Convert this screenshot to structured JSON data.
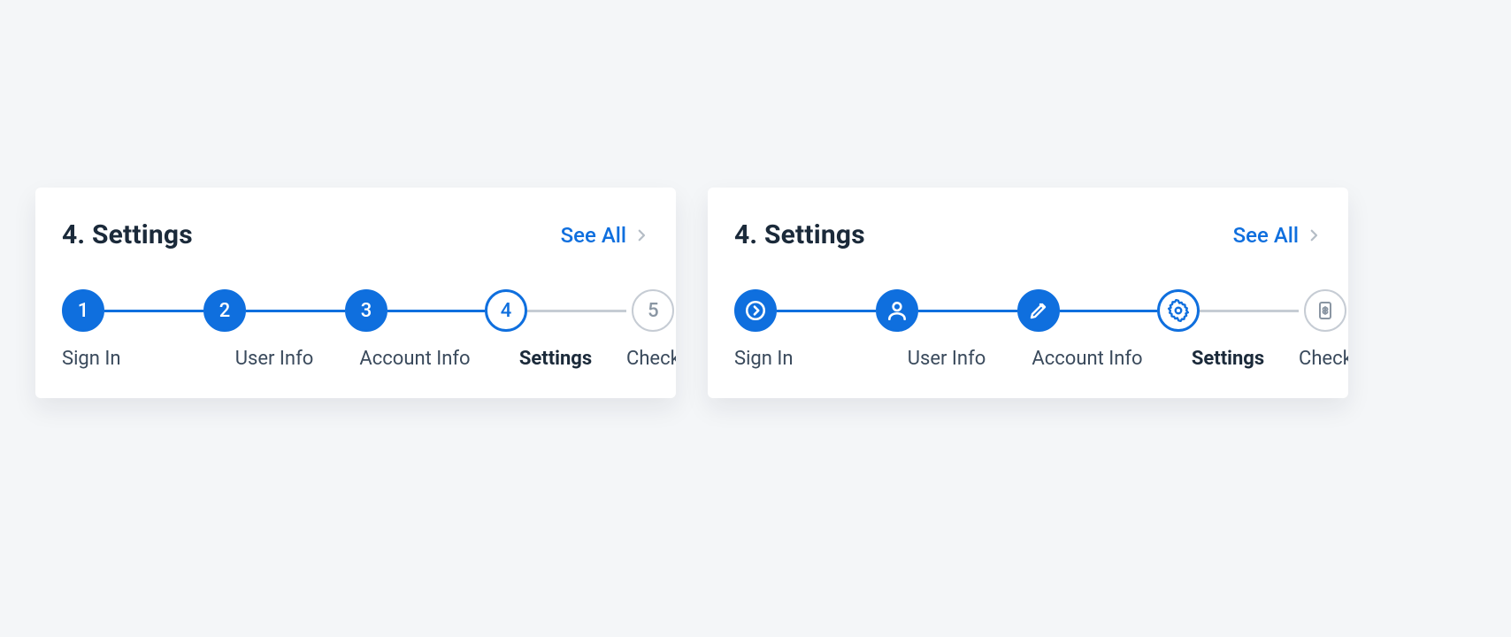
{
  "cards": [
    {
      "id": "number-stepper",
      "title": "4. Settings",
      "see_all": "See All",
      "steps": [
        {
          "label": "Sign In",
          "badge": "1",
          "status": "complete"
        },
        {
          "label": "User Info",
          "badge": "2",
          "status": "complete"
        },
        {
          "label": "Account Info",
          "badge": "3",
          "status": "complete"
        },
        {
          "label": "Settings",
          "badge": "4",
          "status": "active"
        },
        {
          "label": "Check",
          "badge": "5",
          "status": "upcoming"
        }
      ]
    },
    {
      "id": "icon-stepper",
      "title": "4. Settings",
      "see_all": "See All",
      "steps": [
        {
          "label": "Sign In",
          "icon": "arrow-circle-right-icon",
          "status": "complete"
        },
        {
          "label": "User Info",
          "icon": "user-icon",
          "status": "complete"
        },
        {
          "label": "Account Info",
          "icon": "pencil-icon",
          "status": "complete"
        },
        {
          "label": "Settings",
          "icon": "gear-icon",
          "status": "active"
        },
        {
          "label": "Check",
          "icon": "receipt-icon",
          "status": "upcoming"
        }
      ]
    }
  ],
  "colors": {
    "primary": "#0f6fde",
    "muted": "#c6ccd4",
    "text": "#1b2a3a"
  }
}
